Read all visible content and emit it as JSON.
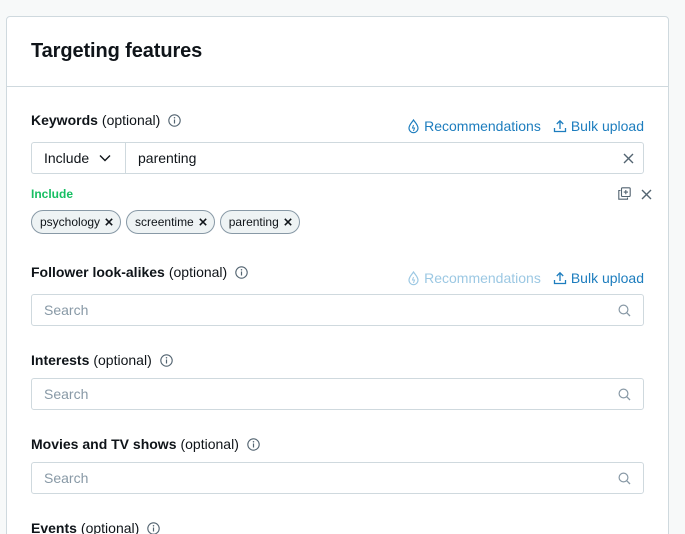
{
  "card": {
    "title": "Targeting features"
  },
  "keywords": {
    "label": "Keywords",
    "optional": "(optional)",
    "recommendations": "Recommendations",
    "bulk_upload": "Bulk upload",
    "match_type": "Include",
    "value": "parenting",
    "group_label": "Include",
    "tags": [
      "psychology",
      "screentime",
      "parenting"
    ]
  },
  "follower_lookalikes": {
    "label": "Follower look-alikes",
    "optional": "(optional)",
    "recommendations": "Recommendations",
    "bulk_upload": "Bulk upload",
    "placeholder": "Search"
  },
  "interests": {
    "label": "Interests",
    "optional": "(optional)",
    "placeholder": "Search"
  },
  "movies_tv": {
    "label": "Movies and TV shows",
    "optional": "(optional)",
    "placeholder": "Search"
  },
  "events": {
    "label": "Events",
    "optional": "(optional)"
  },
  "colors": {
    "accent": "#1d7dbe",
    "include_green": "#17bf63",
    "border": "#cfd9de"
  }
}
